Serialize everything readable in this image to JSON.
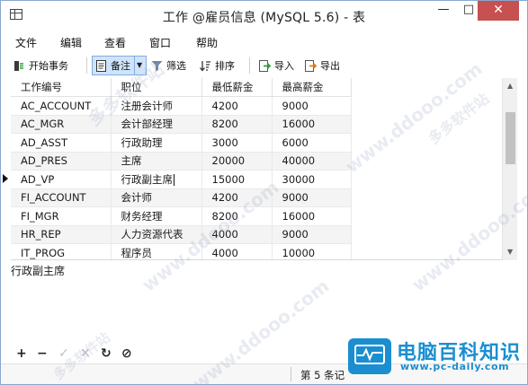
{
  "window": {
    "title": "工作 @雇员信息 (MySQL 5.6) - 表",
    "minimize": "—",
    "maximize": "□",
    "close": "✕"
  },
  "menu": [
    "文件",
    "编辑",
    "查看",
    "窗口",
    "帮助"
  ],
  "toolbar": {
    "begin_transaction": "开始事务",
    "note": "备注",
    "filter": "筛选",
    "sort": "排序",
    "import": "导入",
    "export": "导出"
  },
  "table": {
    "columns": [
      "工作编号",
      "职位",
      "最低薪金",
      "最高薪金"
    ],
    "rows": [
      [
        "AC_ACCOUNT",
        "注册会计师",
        "4200",
        "9000"
      ],
      [
        "AC_MGR",
        "会计部经理",
        "8200",
        "16000"
      ],
      [
        "AD_ASST",
        "行政助理",
        "3000",
        "6000"
      ],
      [
        "AD_PRES",
        "主席",
        "20000",
        "40000"
      ],
      [
        "AD_VP",
        "行政副主席",
        "15000",
        "30000"
      ],
      [
        "FI_ACCOUNT",
        "会计师",
        "4200",
        "9000"
      ],
      [
        "FI_MGR",
        "财务经理",
        "8200",
        "16000"
      ],
      [
        "HR_REP",
        "人力资源代表",
        "4000",
        "9000"
      ],
      [
        "IT_PROG",
        "程序员",
        "4000",
        "10000"
      ]
    ],
    "selected_row": 5
  },
  "memo": {
    "value": "行政副主席"
  },
  "record_controls": {
    "add": "+",
    "delete": "−",
    "apply": "✓",
    "cancel": "✕",
    "refresh": "↻",
    "stop": "⊘"
  },
  "status": {
    "record": "第 5 条记"
  },
  "watermarks": [
    "多多软件站",
    "www.ddooo.com",
    "多多软件站",
    "www.ddooo.com",
    "www.ddooo.com",
    "多多软件站",
    "www.ddooo.com"
  ],
  "logo": {
    "title": "电脑百科知识",
    "url": "www.pc-daily.com"
  },
  "colors": {
    "accent": "#1b8ed0",
    "close_button": "#c75050",
    "selected_tool": "#cfe3fb"
  }
}
